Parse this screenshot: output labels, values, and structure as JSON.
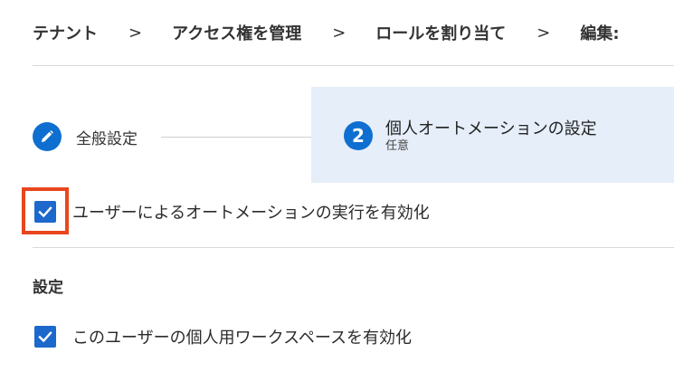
{
  "breadcrumb": {
    "items": [
      "テナント",
      "アクセス権を管理",
      "ロールを割り当て",
      "編集:"
    ],
    "separator": ">"
  },
  "stepper": {
    "step1": {
      "label": "全般設定",
      "icon": "pencil-icon",
      "status": "completed"
    },
    "step2": {
      "number": "2",
      "title": "個人オートメーションの設定",
      "subtitle": "任意",
      "status": "active"
    }
  },
  "options": {
    "enable_automation": {
      "label": "ユーザーによるオートメーションの実行を有効化",
      "checked": true,
      "highlighted": true
    }
  },
  "settings": {
    "title": "設定",
    "enable_workspace": {
      "label": "このユーザーの個人用ワークスペースを有効化",
      "checked": true
    }
  },
  "colors": {
    "accent": "#1c68cc",
    "active_step_bg": "#e5eef9",
    "highlight": "#e8461e"
  }
}
